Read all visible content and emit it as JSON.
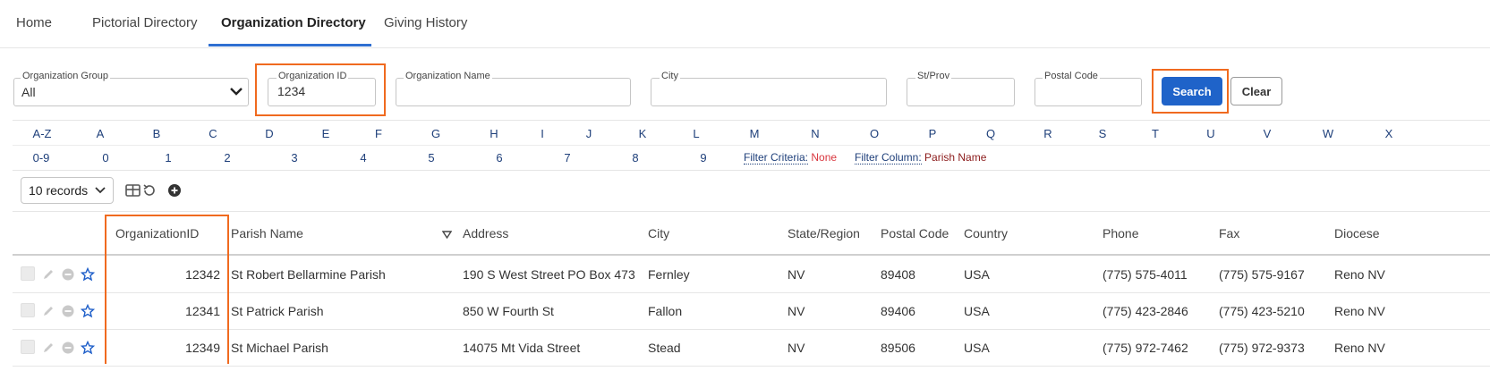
{
  "nav": {
    "tabs": [
      {
        "label": "Home"
      },
      {
        "label": "Pictorial Directory"
      },
      {
        "label": "Organization Directory"
      },
      {
        "label": "Giving History"
      }
    ]
  },
  "filters": {
    "org_group": {
      "label": "Organization Group",
      "value": "All"
    },
    "org_id": {
      "label": "Organization ID",
      "value": "1234"
    },
    "org_name": {
      "label": "Organization Name",
      "value": ""
    },
    "city": {
      "label": "City",
      "value": ""
    },
    "st_prov": {
      "label": "St/Prov",
      "value": ""
    },
    "postal": {
      "label": "Postal Code",
      "value": ""
    },
    "search_label": "Search",
    "clear_label": "Clear"
  },
  "alpha": {
    "letters": [
      "A-Z",
      "A",
      "B",
      "C",
      "D",
      "E",
      "F",
      "G",
      "H",
      "I",
      "J",
      "K",
      "L",
      "M",
      "N",
      "O",
      "P",
      "Q",
      "R",
      "S",
      "T",
      "U",
      "V",
      "W",
      "X"
    ],
    "digits": [
      "0-9",
      "0",
      "1",
      "2",
      "3",
      "4",
      "5",
      "6",
      "7",
      "8",
      "9"
    ],
    "filter_criteria_label": "Filter Criteria:",
    "filter_criteria_value": "None",
    "filter_column_label": "Filter Column:",
    "filter_column_value": "Parish Name"
  },
  "toolbar": {
    "records_label": "10 records"
  },
  "table": {
    "columns": [
      "OrganizationID",
      "Parish Name",
      "Address",
      "City",
      "State/Region",
      "Postal Code",
      "Country",
      "Phone",
      "Fax",
      "Diocese"
    ],
    "rows": [
      [
        "12342",
        "St Robert Bellarmine Parish",
        "190 S West Street PO Box 473",
        "Fernley",
        "NV",
        "89408",
        "USA",
        "(775) 575-4011",
        "(775) 575-9167",
        "Reno NV"
      ],
      [
        "12341",
        "St Patrick Parish",
        "850 W Fourth St",
        "Fallon",
        "NV",
        "89406",
        "USA",
        "(775) 423-2846",
        "(775) 423-5210",
        "Reno NV"
      ],
      [
        "12349",
        "St Michael Parish",
        "14075 Mt Vida Street",
        "Stead",
        "NV",
        "89506",
        "USA",
        "(775) 972-7462",
        "(775) 972-9373",
        "Reno NV"
      ]
    ]
  },
  "colors": {
    "accent": "#1f63c9",
    "highlight": "#f06a1f",
    "link": "#1e3f7a",
    "none_red": "#d9363e",
    "column_red": "#8b1a1a"
  }
}
